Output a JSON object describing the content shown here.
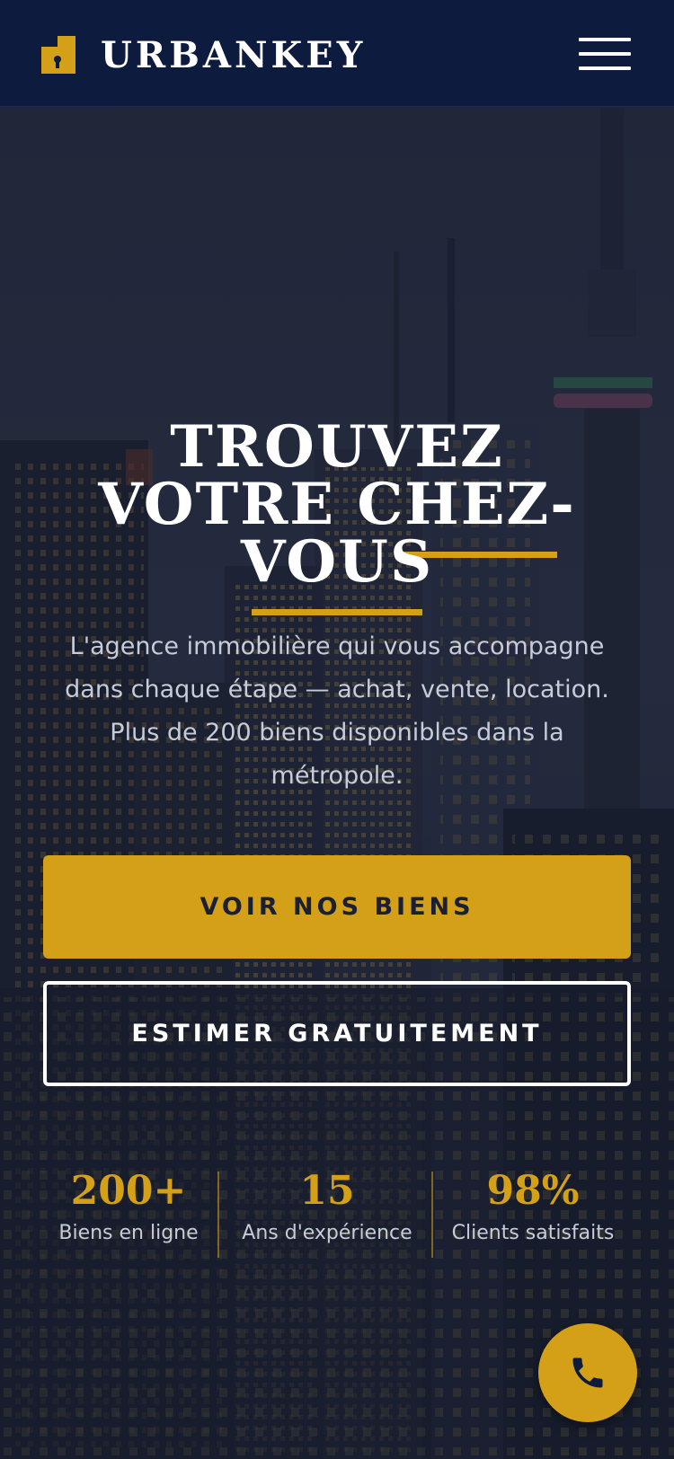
{
  "header": {
    "brand": "URBANKEY",
    "menu_icon": "hamburger-menu-icon",
    "logo_icon": "building-key-icon"
  },
  "hero": {
    "title": "TROUVEZ VOTRE CHEZ-VOUS",
    "subtitle": "L'agence immobilière qui vous accompagne dans chaque étape — achat, vente, location. Plus de 200 biens disponibles dans la métropole.",
    "primary_button": "VOIR NOS BIENS",
    "secondary_button": "ESTIMER GRATUITEMENT"
  },
  "stats": [
    {
      "value": "200+",
      "label": "Biens en ligne"
    },
    {
      "value": "15",
      "label": "Ans d'expérience"
    },
    {
      "value": "98%",
      "label": "Clients satisfaits"
    }
  ],
  "call_button": {
    "icon": "phone-icon"
  },
  "colors": {
    "accent": "#d4a017",
    "header_bg": "#0d1b3e",
    "text_light": "#ffffff",
    "text_muted": "#c7ccd8"
  }
}
